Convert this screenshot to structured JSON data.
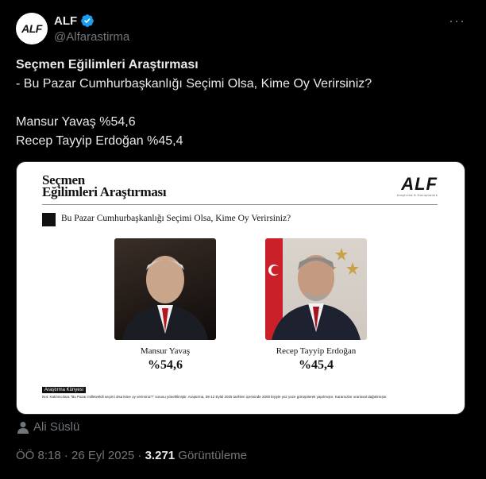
{
  "tweet": {
    "display_name": "ALF",
    "handle": "@Alfarastirma",
    "avatar_text": "ALF",
    "verified": true,
    "line1": "Seçmen Eğilimleri Araştırması",
    "line2": "- Bu Pazar Cumhurbaşkanlığı Seçimi Olsa, Kime Oy Verirsiniz?",
    "line3": "Mansur Yavaş %54,6",
    "line4": "Recep Tayyip Erdoğan %45,4",
    "author": "Ali Süslü",
    "time": "ÖÖ 8:18 · 26 Eyl 2025 · ",
    "views_count": "3.271",
    "views_label": " Görüntüleme"
  },
  "card": {
    "title_line1": "Seçmen",
    "title_line2": "Eğilimleri Araştırması",
    "logo": "ALF",
    "logo_sub": "Araştırma & Danışmanlık",
    "question": "Bu Pazar Cumhurbaşkanlığı Seçimi Olsa, Kime Oy Verirsiniz?",
    "candidates": [
      {
        "name": "Mansur Yavaş",
        "percent": "%54,6"
      },
      {
        "name": "Recep Tayyip Erdoğan",
        "percent": "%45,4"
      }
    ],
    "kunye_label": "Araştırma Künyesi",
    "kunye_note": "Not: Katılımcılara \"Bu Pazar milletvekili seçimi olsa kime oy verirsiniz?\" sorusu yöneltilmiştir. Araştırma, 08-12 Eylül 2025 tarihleri içerisinde 2000 kişiyle yüz yüze görüşülerek yapılmıştır. Kararsızlar orantısal dağıtılmıştır."
  },
  "colors": {
    "background": "#000000",
    "verified": "#1d9bf0",
    "muted": "#71767b",
    "text": "#e7e9ea"
  },
  "icons": {
    "verified": "verified-badge-icon",
    "more": "more-dots-icon",
    "person": "person-icon"
  }
}
